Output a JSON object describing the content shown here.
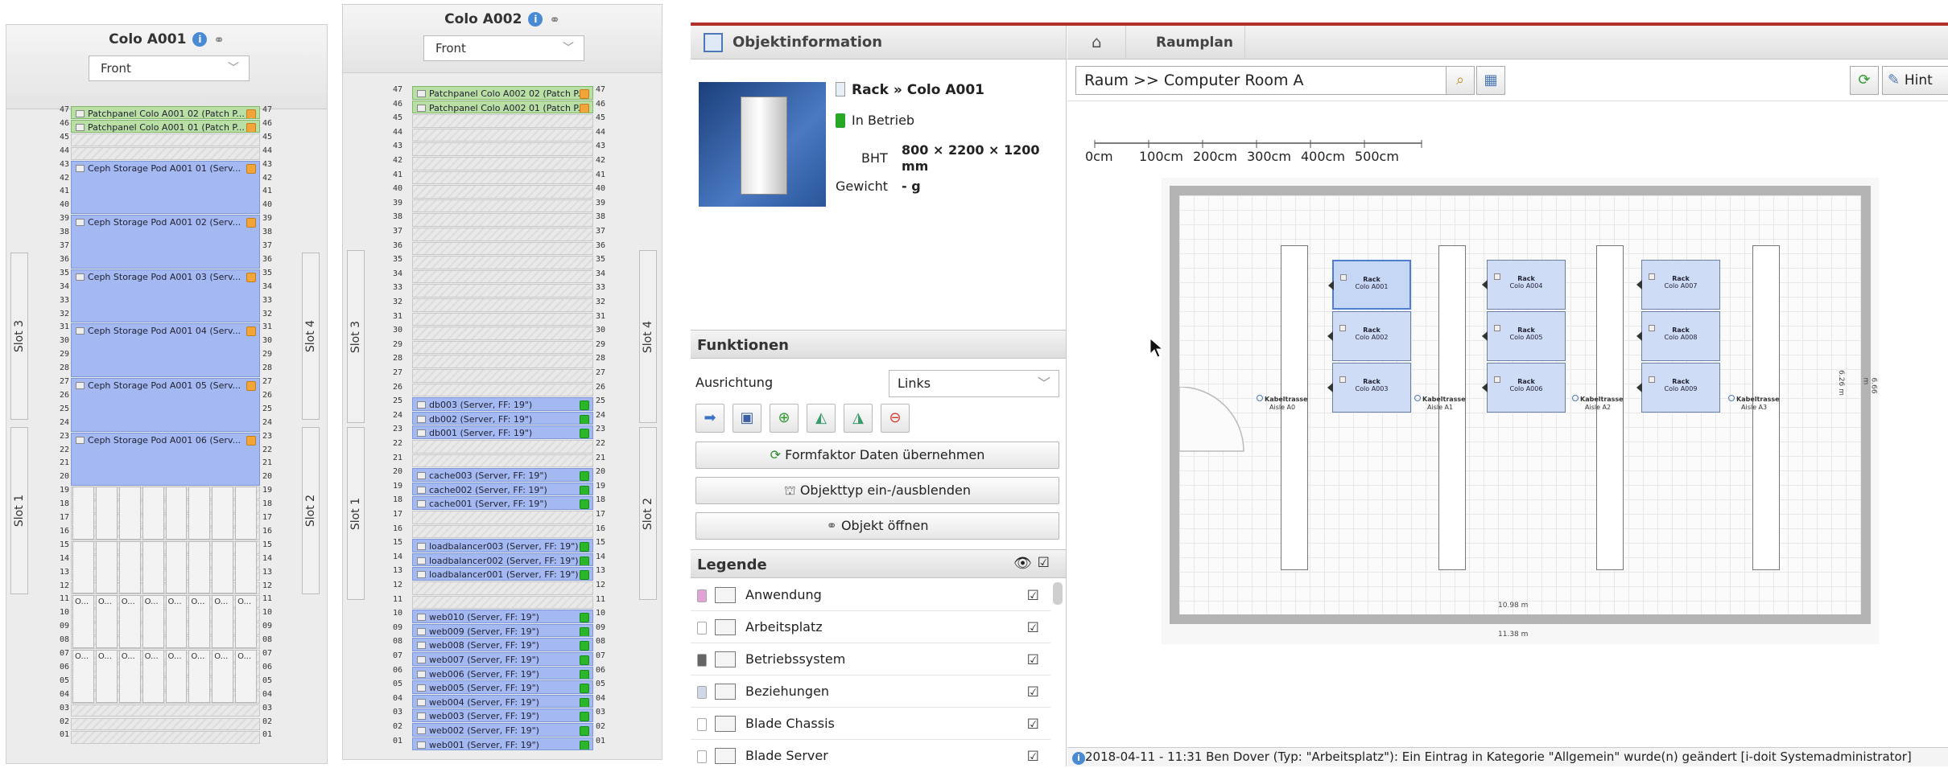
{
  "rack_a001": {
    "title": "Colo A001",
    "view": "Front",
    "unit_labels_left": [
      "47",
      "46",
      "45",
      "44",
      "43",
      "42",
      "41",
      "40",
      "39",
      "38",
      "37",
      "36",
      "35",
      "34",
      "33",
      "32",
      "31",
      "30",
      "29",
      "28",
      "27",
      "26",
      "25",
      "24",
      "23",
      "22",
      "21",
      "20",
      "19",
      "18",
      "17",
      "16",
      "15",
      "14",
      "13",
      "12",
      "11",
      "10",
      "09",
      "08",
      "07",
      "06",
      "05",
      "04",
      "03",
      "02",
      "01"
    ],
    "unit_labels_right": [
      "47",
      "46",
      "45",
      "44",
      "43",
      "42",
      "41",
      "40",
      "39",
      "38",
      "37",
      "36",
      "35",
      "34",
      "33",
      "32",
      "31",
      "30",
      "29",
      "28",
      "27",
      "26",
      "25",
      "24",
      "23",
      "22",
      "21",
      "20",
      "19",
      "18",
      "17",
      "16",
      "15",
      "14",
      "13",
      "12",
      "11",
      "10",
      "09",
      "08",
      "07",
      "06",
      "05",
      "04",
      "03",
      "02",
      "01"
    ],
    "devices": [
      {
        "label": "Patchpanel Colo A001 02 (Patch P...",
        "color": "green",
        "status": "orange"
      },
      {
        "label": "Patchpanel Colo A001 01 (Patch P...",
        "color": "green",
        "status": "orange"
      },
      {
        "label": "Ceph Storage Pod A001 01 (Serv...",
        "color": "blue",
        "status": "orange"
      },
      {
        "label": "Ceph Storage Pod A001 02 (Serv...",
        "color": "blue",
        "status": "orange"
      },
      {
        "label": "Ceph Storage Pod A001 03 (Serv...",
        "color": "blue",
        "status": "orange"
      },
      {
        "label": "Ceph Storage Pod A001 04 (Serv...",
        "color": "blue",
        "status": "orange"
      },
      {
        "label": "Ceph Storage Pod A001 05 (Serv...",
        "color": "blue",
        "status": "orange"
      },
      {
        "label": "Ceph Storage Pod A001 06 (Serv...",
        "color": "blue",
        "status": "orange"
      }
    ],
    "slots": {
      "top_left": "Slot 3",
      "bottom_left": "Slot 1",
      "top_right": "Slot 4",
      "bottom_right": "Slot 2"
    },
    "bay_labels": [
      "O...",
      "O...",
      "O...",
      "O...",
      "O...",
      "O...",
      "O...",
      "O..."
    ]
  },
  "rack_a002": {
    "title": "Colo A002",
    "view": "Front",
    "unit_labels_left": [
      "47",
      "46",
      "45",
      "44",
      "43",
      "42",
      "41",
      "40",
      "39",
      "38",
      "37",
      "36",
      "35",
      "34",
      "33",
      "32",
      "31",
      "30",
      "29",
      "28",
      "27",
      "26",
      "25",
      "24",
      "23",
      "22",
      "21",
      "20",
      "19",
      "18",
      "17",
      "16",
      "15",
      "14",
      "13",
      "12",
      "11",
      "10",
      "09",
      "08",
      "07",
      "06",
      "05",
      "04",
      "03",
      "02",
      "01"
    ],
    "unit_labels_right": [
      "47",
      "46",
      "45",
      "44",
      "43",
      "42",
      "41",
      "40",
      "39",
      "38",
      "37",
      "36",
      "35",
      "34",
      "33",
      "32",
      "31",
      "30",
      "29",
      "28",
      "27",
      "26",
      "25",
      "24",
      "23",
      "22",
      "21",
      "20",
      "19",
      "18",
      "17",
      "16",
      "15",
      "14",
      "13",
      "12",
      "11",
      "10",
      "09",
      "08",
      "07",
      "06",
      "05",
      "04",
      "03",
      "02",
      "01"
    ],
    "devices": [
      {
        "label": "Patchpanel Colo A002 02 (Patch P...",
        "color": "green",
        "status": "orange"
      },
      {
        "label": "Patchpanel Colo A002 01 (Patch P...",
        "color": "green",
        "status": "orange"
      },
      {
        "label": "db003 (Server, FF: 19\")",
        "color": "blue",
        "status": "green"
      },
      {
        "label": "db002 (Server, FF: 19\")",
        "color": "blue",
        "status": "green"
      },
      {
        "label": "db001 (Server, FF: 19\")",
        "color": "blue",
        "status": "green"
      },
      {
        "label": "cache003 (Server, FF: 19\")",
        "color": "blue",
        "status": "green"
      },
      {
        "label": "cache002 (Server, FF: 19\")",
        "color": "blue",
        "status": "green"
      },
      {
        "label": "cache001 (Server, FF: 19\")",
        "color": "blue",
        "status": "green"
      },
      {
        "label": "loadbalancer003 (Server, FF: 19\")",
        "color": "blue",
        "status": "green"
      },
      {
        "label": "loadbalancer002 (Server, FF: 19\")",
        "color": "blue",
        "status": "green"
      },
      {
        "label": "loadbalancer001 (Server, FF: 19\")",
        "color": "blue",
        "status": "green"
      },
      {
        "label": "web010 (Server, FF: 19\")",
        "color": "blue",
        "status": "green"
      },
      {
        "label": "web009 (Server, FF: 19\")",
        "color": "blue",
        "status": "green"
      },
      {
        "label": "web008 (Server, FF: 19\")",
        "color": "blue",
        "status": "green"
      },
      {
        "label": "web007 (Server, FF: 19\")",
        "color": "blue",
        "status": "green"
      },
      {
        "label": "web006 (Server, FF: 19\")",
        "color": "blue",
        "status": "green"
      },
      {
        "label": "web005 (Server, FF: 19\")",
        "color": "blue",
        "status": "green"
      },
      {
        "label": "web004 (Server, FF: 19\")",
        "color": "blue",
        "status": "green"
      },
      {
        "label": "web003 (Server, FF: 19\")",
        "color": "blue",
        "status": "green"
      },
      {
        "label": "web002 (Server, FF: 19\")",
        "color": "blue",
        "status": "green"
      },
      {
        "label": "web001 (Server, FF: 19\")",
        "color": "blue",
        "status": "green"
      }
    ],
    "slots": {
      "top_left": "Slot 3",
      "bottom_left": "Slot 1",
      "top_right": "Slot 4",
      "bottom_right": "Slot 2"
    }
  },
  "object_info": {
    "header": "Objektinformation",
    "name": "Rack » Colo A001",
    "status": "In Betrieb",
    "bht_label": "BHT",
    "bht_value": "800 × 2200 × 1200 mm",
    "weight_label": "Gewicht",
    "weight_value": "- g"
  },
  "functions": {
    "header": "Funktionen",
    "orientation_label": "Ausrichtung",
    "orientation_value": "Links",
    "btn_formfactor": "Formfaktor Daten übernehmen",
    "btn_objecttype": "Objekttyp ein-/ausblenden",
    "btn_open": "Objekt öffnen"
  },
  "legend": {
    "header": "Legende",
    "items": [
      {
        "label": "Anwendung",
        "color": "#e2a3d6"
      },
      {
        "label": "Arbeitsplatz",
        "color": "#ffffff"
      },
      {
        "label": "Betriebssystem",
        "color": "#666666"
      },
      {
        "label": "Beziehungen",
        "color": "#cfd8e6"
      },
      {
        "label": "Blade Chassis",
        "color": "#ffffff"
      },
      {
        "label": "Blade Server",
        "color": "#ffffff"
      }
    ]
  },
  "breadcrumb": {
    "item": "Raumplan"
  },
  "path": "Raum >> Computer Room A",
  "hint_label": "Hint",
  "scale_labels": [
    "0cm",
    "100cm",
    "200cm",
    "300cm",
    "400cm",
    "500cm"
  ],
  "floorplan": {
    "racks": [
      {
        "title": "Rack",
        "name": "Colo A001"
      },
      {
        "title": "Rack",
        "name": "Colo A002"
      },
      {
        "title": "Rack",
        "name": "Colo A003"
      },
      {
        "title": "Rack",
        "name": "Colo A004"
      },
      {
        "title": "Rack",
        "name": "Colo A005"
      },
      {
        "title": "Rack",
        "name": "Colo A006"
      },
      {
        "title": "Rack",
        "name": "Colo A007"
      },
      {
        "title": "Rack",
        "name": "Colo A008"
      },
      {
        "title": "Rack",
        "name": "Colo A009"
      }
    ],
    "trays": [
      {
        "title": "Kabeltrasse",
        "name": "Aisle A0"
      },
      {
        "title": "Kabeltrasse",
        "name": "Aisle A1"
      },
      {
        "title": "Kabeltrasse",
        "name": "Aisle A2"
      },
      {
        "title": "Kabeltrasse",
        "name": "Aisle A3"
      }
    ],
    "dim_inner": "10.98 m",
    "dim_outer": "11.38 m",
    "dim_side_inner": "6.26 m",
    "dim_side_outer": "6.66 m"
  },
  "status_message": "2018-04-11 - 11:31 Ben Dover (Typ: \"Arbeitsplatz\"): Ein Eintrag in Kategorie \"Allgemein\" wurde(n) geändert [i-doit Systemadministrator]"
}
